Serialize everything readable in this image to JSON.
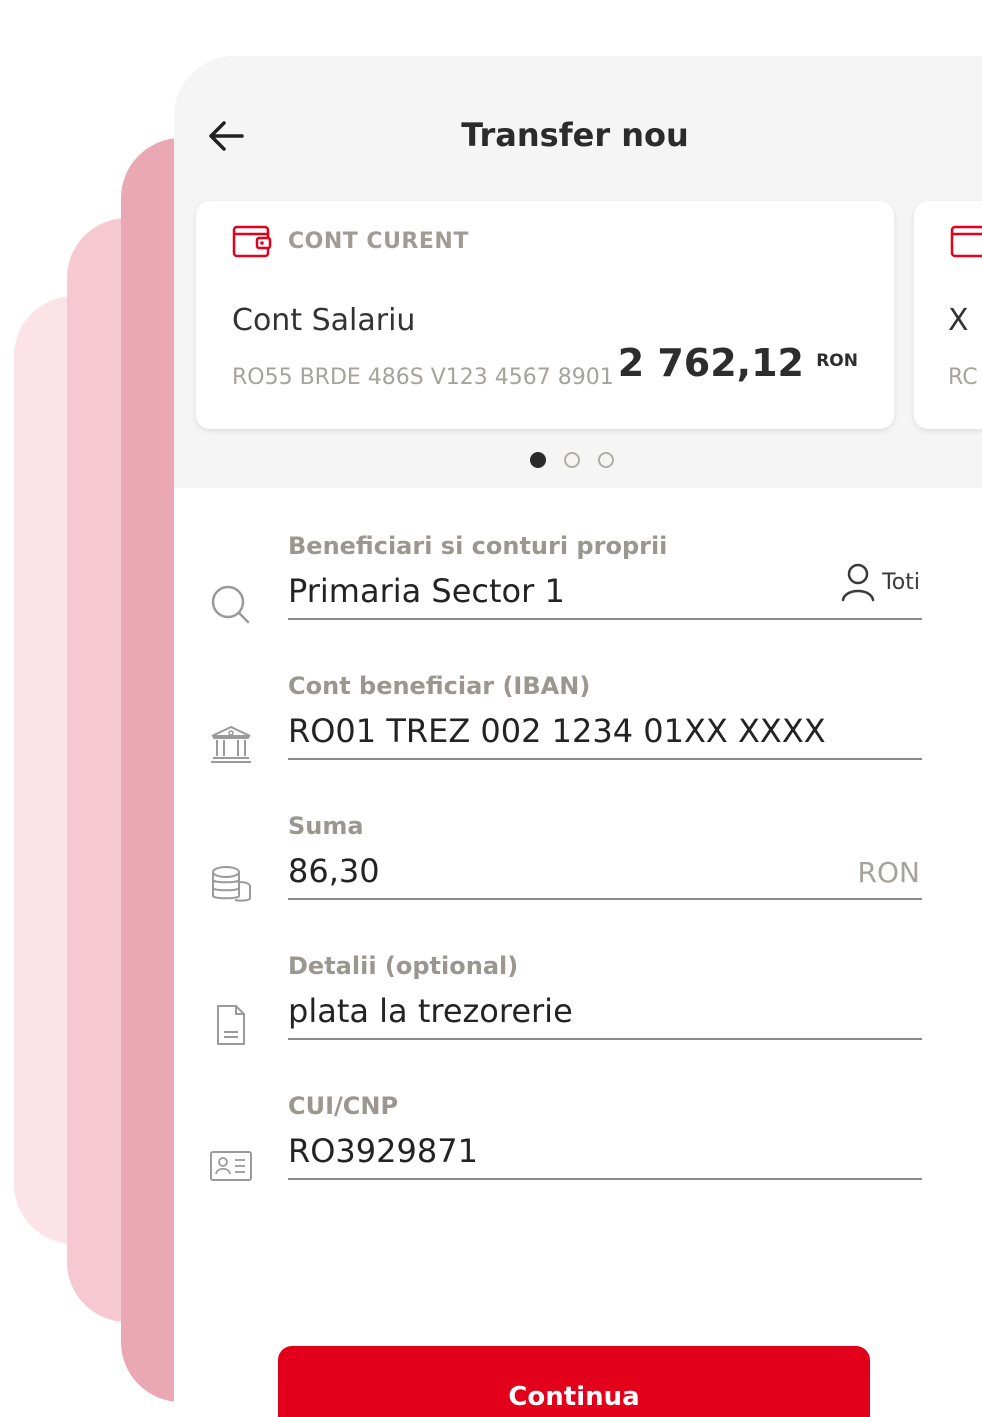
{
  "header": {
    "title": "Transfer nou"
  },
  "account_card": {
    "type": "CONT CURENT",
    "name": "Cont Salariu",
    "iban": "RO55 BRDE 486S V123 4567 8901",
    "balance": "2 762,12",
    "currency": "RON"
  },
  "next_card": {
    "name": "X",
    "iban": "RC"
  },
  "carousel": {
    "active_index": 0,
    "count": 3
  },
  "fields": {
    "beneficiary": {
      "label": "Beneficiari si conturi proprii",
      "value": "Primaria Sector 1",
      "toti_label": "Toti"
    },
    "iban": {
      "label": "Cont beneficiar (IBAN)",
      "value": "RO01 TREZ 002 1234 01XX XXXX"
    },
    "amount": {
      "label": "Suma",
      "value": "86,30",
      "currency": "RON"
    },
    "details": {
      "label": "Detalii (optional)",
      "value": "plata la trezorerie"
    },
    "cui": {
      "label": "CUI/CNP",
      "value": "RO3929871"
    }
  },
  "actions": {
    "continue_label": "Continua"
  },
  "colors": {
    "accent": "#e2001a",
    "card_icon": "#e2001a"
  }
}
